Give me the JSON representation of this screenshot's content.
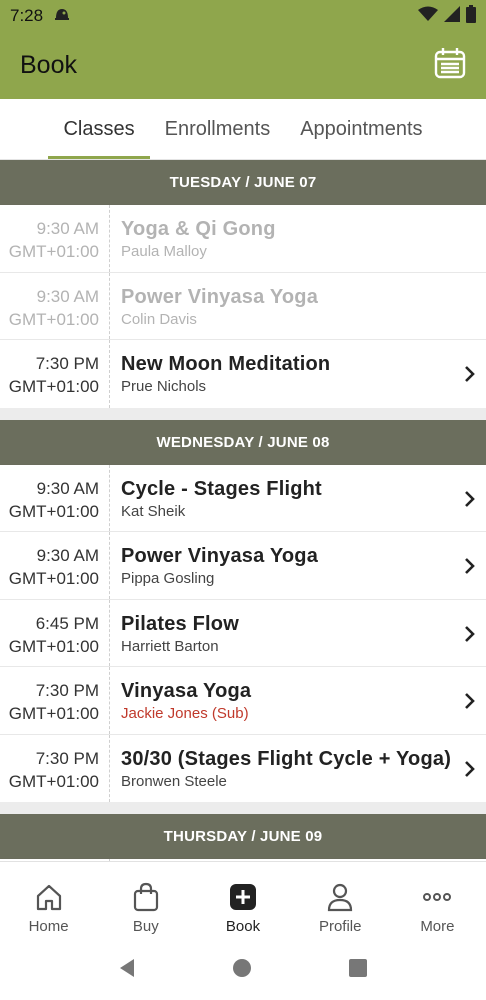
{
  "status_bar": {
    "time": "7:28"
  },
  "app_bar": {
    "title": "Book"
  },
  "tabs": [
    {
      "label": "Classes",
      "active": true
    },
    {
      "label": "Enrollments",
      "active": false
    },
    {
      "label": "Appointments",
      "active": false
    }
  ],
  "days": [
    {
      "header": "TUESDAY / JUNE 07",
      "classes": [
        {
          "time": "9:30 AM",
          "tz": "GMT+01:00",
          "name": "Yoga & Qi Gong",
          "instructor": "Paula Malloy",
          "past": true,
          "sub": false
        },
        {
          "time": "9:30 AM",
          "tz": "GMT+01:00",
          "name": "Power Vinyasa Yoga",
          "instructor": "Colin Davis",
          "past": true,
          "sub": false
        },
        {
          "time": "7:30 PM",
          "tz": "GMT+01:00",
          "name": "New Moon Meditation",
          "instructor": "Prue Nichols",
          "past": false,
          "sub": false
        }
      ]
    },
    {
      "header": "WEDNESDAY / JUNE 08",
      "classes": [
        {
          "time": "9:30 AM",
          "tz": "GMT+01:00",
          "name": "Cycle - Stages Flight",
          "instructor": "Kat Sheik",
          "past": false,
          "sub": false
        },
        {
          "time": "9:30 AM",
          "tz": "GMT+01:00",
          "name": "Power Vinyasa Yoga",
          "instructor": "Pippa Gosling",
          "past": false,
          "sub": false
        },
        {
          "time": "6:45 PM",
          "tz": "GMT+01:00",
          "name": "Pilates Flow",
          "instructor": "Harriett Barton",
          "past": false,
          "sub": false
        },
        {
          "time": "7:30 PM",
          "tz": "GMT+01:00",
          "name": "Vinyasa Yoga",
          "instructor": "Jackie Jones (Sub)",
          "past": false,
          "sub": true
        },
        {
          "time": "7:30 PM",
          "tz": "GMT+01:00",
          "name": "30/30 (Stages Flight Cycle + Yoga)",
          "instructor": "Bronwen Steele",
          "past": false,
          "sub": false
        }
      ]
    },
    {
      "header": "THURSDAY / JUNE 09",
      "classes": []
    }
  ],
  "bottom_nav": [
    {
      "label": "Home",
      "icon": "home-icon",
      "active": false
    },
    {
      "label": "Buy",
      "icon": "shopping-bag-icon",
      "active": false
    },
    {
      "label": "Book",
      "icon": "plus-square-icon",
      "active": true
    },
    {
      "label": "Profile",
      "icon": "person-icon",
      "active": false
    },
    {
      "label": "More",
      "icon": "more-dots-icon",
      "active": false
    }
  ],
  "colors": {
    "brand": "#8fa64c",
    "day_header": "#6b6e5d",
    "sub_instructor": "#c0392b"
  }
}
